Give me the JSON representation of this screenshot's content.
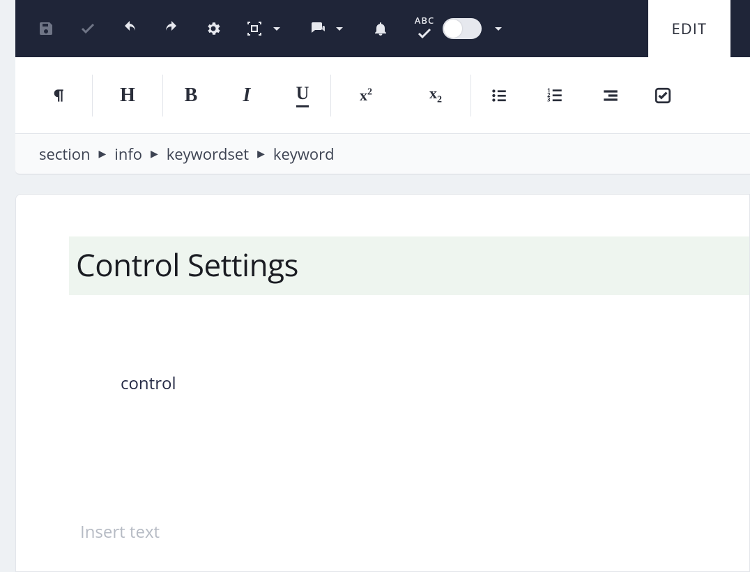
{
  "top_toolbar": {
    "save": "save",
    "confirm": "confirm",
    "undo": "undo",
    "redo": "redo",
    "settings": "settings",
    "frame": "frame",
    "comments": "comments",
    "notifications": "notifications",
    "spellcheck_label": "ABC",
    "edit_tab": "EDIT"
  },
  "format_toolbar": {
    "paragraph": "¶",
    "heading": "H",
    "bold": "B",
    "italic": "I",
    "underline": "U",
    "superscript_base": "x",
    "superscript_exp": "2",
    "subscript_base": "x",
    "subscript_exp": "2"
  },
  "breadcrumb": [
    "section",
    "info",
    "keywordset",
    "keyword"
  ],
  "document": {
    "title": "Control Settings",
    "keyword": "control",
    "placeholder": "Insert text"
  }
}
